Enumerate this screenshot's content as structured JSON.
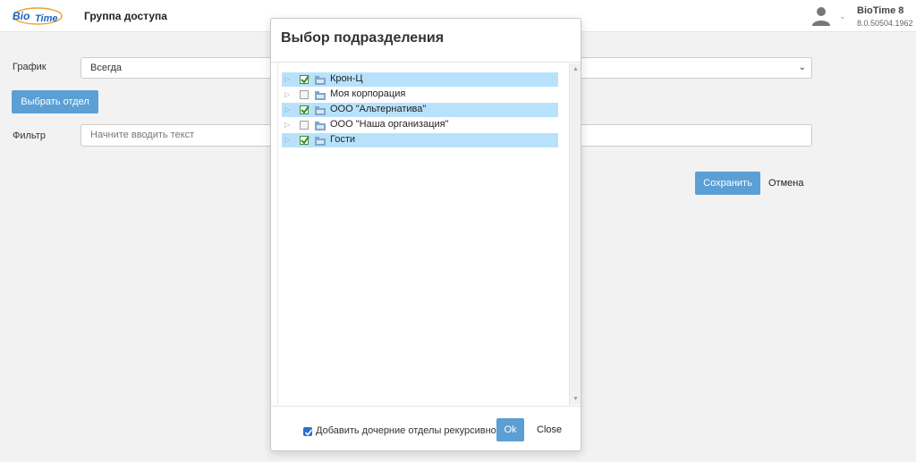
{
  "header": {
    "logo_part1": "Bio",
    "logo_part2": "Time",
    "page_title": "Группа доступа",
    "app_name": "BioTime 8",
    "app_version": "8.0.50504.1962"
  },
  "form": {
    "schedule_label": "График",
    "schedule_value": "Всегда",
    "select_department_button": "Выбрать отдел",
    "filter_label": "Фильтр",
    "filter_placeholder": "Начните вводить текст",
    "save_button": "Сохранить",
    "cancel_button": "Отмена"
  },
  "dialog": {
    "title": "Выбор подразделения",
    "tree": [
      {
        "label": "Крон-Ц",
        "checked": true,
        "selected": true
      },
      {
        "label": "Моя корпорация",
        "checked": false,
        "selected": false
      },
      {
        "label": "ООО \"Альтернатива\"",
        "checked": true,
        "selected": true
      },
      {
        "label": "ООО \"Наша организация\"",
        "checked": false,
        "selected": false
      },
      {
        "label": "Гости",
        "checked": true,
        "selected": true
      }
    ],
    "recursive_label": "Добавить дочерние отделы рекурсивно",
    "recursive_checked": true,
    "ok_button": "Ok",
    "close_button": "Close"
  },
  "colors": {
    "primary": "#5b9fd4",
    "selected_row": "#b8e2fb",
    "check_green": "#4a8b3a"
  },
  "icons": {
    "expander": "triangle-right-icon",
    "folder": "department-folder-icon",
    "avatar": "user-avatar-icon"
  }
}
